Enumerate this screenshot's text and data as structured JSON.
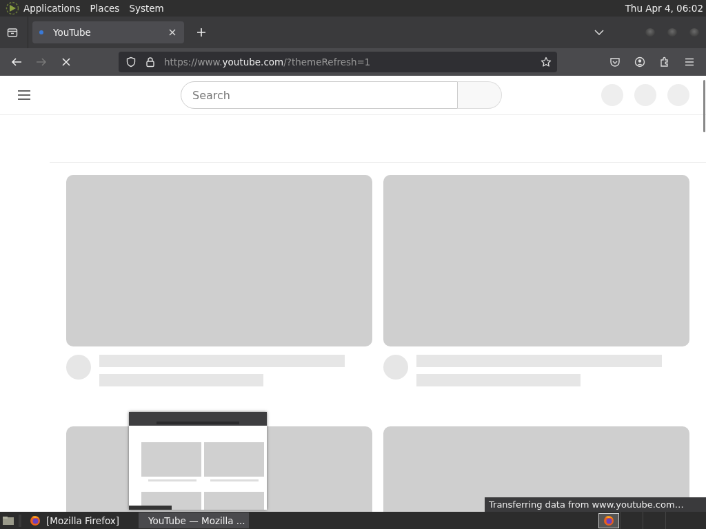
{
  "top_panel": {
    "menus": [
      "Applications",
      "Places",
      "System"
    ],
    "clock": "Thu Apr  4, 06:02"
  },
  "browser": {
    "tabs": [
      {
        "label": "YouTube",
        "selected": true
      }
    ],
    "navigation": [
      {
        "kind": "back",
        "disabled": false
      },
      {
        "kind": "forward",
        "disabled": true
      },
      {
        "kind": "stop",
        "disabled": false
      }
    ],
    "url": {
      "prefix": "https://www.",
      "domain": "youtube.com",
      "suffix": "/?themeRefresh=1"
    },
    "page": {
      "search": {
        "placeholder": "Search"
      }
    },
    "status": "Transferring data from www.youtube.com…"
  },
  "taskbar": {
    "windows": [
      {
        "label": "[Mozilla Firefox]",
        "selected": false
      },
      {
        "label": "YouTube — Mozilla ...",
        "selected": true
      }
    ]
  }
}
